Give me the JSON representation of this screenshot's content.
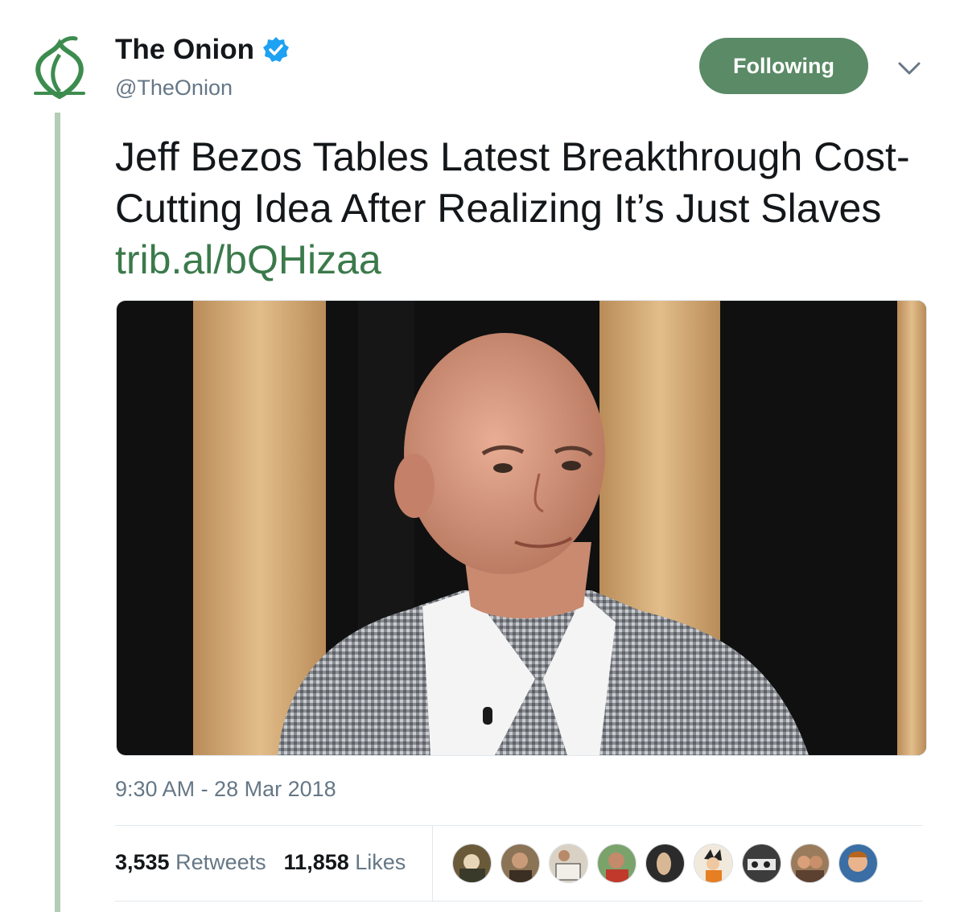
{
  "author": {
    "display_name": "The Onion",
    "handle": "@TheOnion",
    "verified_icon": "verified-badge-icon",
    "avatar_icon": "onion-logo-icon"
  },
  "follow_button": {
    "label": "Following"
  },
  "menu_icon": "chevron-down-icon",
  "tweet": {
    "text": "Jeff Bezos Tables Latest Breakthrough Cost-Cutting Idea After Realizing It’s Just Slaves ",
    "link": "trib.al/bQHizaa"
  },
  "timestamp": "9:30 AM - 28 Mar 2018",
  "stats": {
    "retweets_count": "3,535",
    "retweets_label": "Retweets",
    "likes_count": "11,858",
    "likes_label": "Likes"
  },
  "colors": {
    "brand_green": "#5a8a66",
    "link_green": "#3b7a4b",
    "thread_line": "#b3cdb8",
    "verified_blue": "#1da1f2"
  }
}
